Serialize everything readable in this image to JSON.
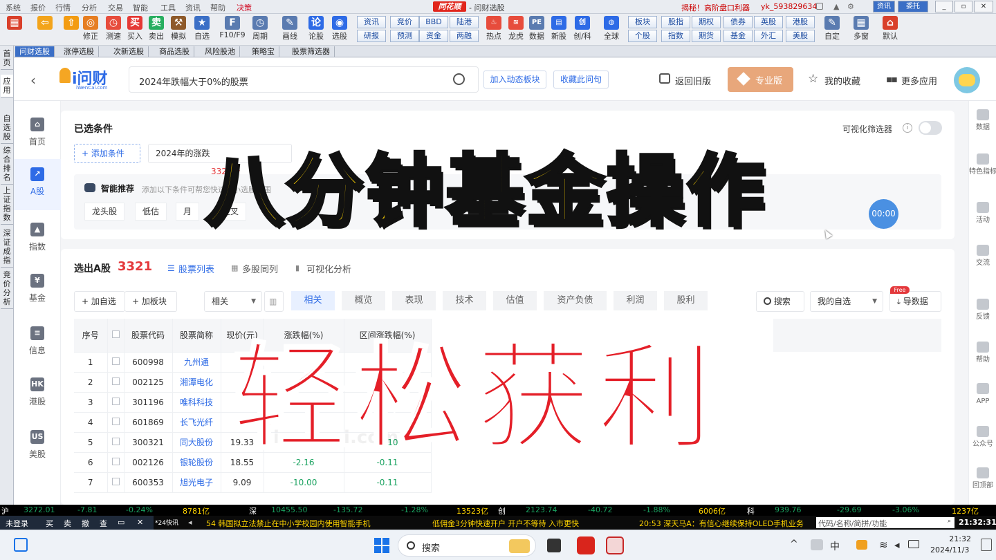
{
  "menubar": {
    "items": [
      "系统",
      "报价",
      "行情",
      "分析",
      "交易",
      "智能",
      "工具",
      "资讯",
      "帮助",
      "决策"
    ],
    "app_logo": "同花顺",
    "caption": "- 问财选股",
    "promo": "揭秘！高阶盘口利器",
    "user": "yk_593829634",
    "news_btn": "资讯",
    "account_btn": "委托",
    "win": [
      "_",
      "▫",
      "✕"
    ]
  },
  "toolbar": {
    "tools": [
      {
        "label": "",
        "color": "#d9402b",
        "icon": "▦"
      },
      {
        "label": "",
        "color": "#f3a41b",
        "icon": "⇦"
      },
      {
        "label": "",
        "color": "#f39c12",
        "icon": "⇧"
      },
      {
        "label": "修正",
        "color": "#e67e22",
        "icon": "◎"
      },
      {
        "label": "测速",
        "color": "#e74c3c",
        "icon": "◷"
      },
      {
        "label": "买入",
        "color": "#e53935",
        "icon": "买"
      },
      {
        "label": "卖出",
        "color": "#27ae60",
        "icon": "卖"
      },
      {
        "label": "模拟",
        "color": "#8e5a2b",
        "icon": "⚒"
      },
      {
        "label": "自选",
        "color": "#3b6fc6",
        "icon": "★"
      },
      {
        "label": "F10/F9",
        "color": "#5a7bb0",
        "icon": "F"
      },
      {
        "label": "周期",
        "color": "#5a7bb0",
        "icon": "◷"
      },
      {
        "label": "画线",
        "color": "#5a7bb0",
        "icon": "✎"
      },
      {
        "label": "论股",
        "color": "#2e6be6",
        "icon": "论"
      },
      {
        "label": "选股",
        "color": "#2e6be6",
        "icon": "◉"
      }
    ],
    "quick": [
      [
        "资讯",
        "研报"
      ],
      [
        "竞价",
        "预测"
      ],
      [
        "BBD",
        "资金"
      ],
      [
        "陆港",
        "两融"
      ]
    ],
    "tools2": [
      {
        "label": "热点",
        "icon": "♨",
        "color": "#e74c3c"
      },
      {
        "label": "龙虎",
        "icon": "≋",
        "color": "#e74c3c"
      },
      {
        "label": "数据",
        "icon": "PE",
        "color": "#5a7bb0"
      },
      {
        "label": "新股",
        "icon": "▤",
        "color": "#2e6be6"
      },
      {
        "label": "创/科",
        "icon": "创",
        "color": "#2e6be6"
      },
      {
        "label": "全球",
        "icon": "◍",
        "color": "#2e6be6"
      }
    ],
    "quick2": [
      [
        "板块",
        "个股"
      ],
      [
        "股指",
        "指数"
      ],
      [
        "期权",
        "期货"
      ],
      [
        "债券",
        "基金"
      ],
      [
        "英股",
        "外汇"
      ],
      [
        "港股",
        "美股"
      ]
    ],
    "tools3": [
      {
        "label": "自定",
        "icon": "✎",
        "color": "#5a7bb0"
      },
      {
        "label": "多窗",
        "icon": "▦",
        "color": "#5a7bb0"
      },
      {
        "label": "默认",
        "icon": "⌂",
        "color": "#d9402b"
      }
    ]
  },
  "tabs": [
    "问财选股",
    "涨停选股",
    "次新选股",
    "商品选股",
    "风险股池",
    "策略宝",
    "股票筛选器"
  ],
  "vtabs": [
    "首页",
    "应用",
    "自选股",
    "综合排名",
    "上证指数",
    "深证成指",
    "竞价分析"
  ],
  "header": {
    "logo": "i问财",
    "logo_sub": "iWenCai.com",
    "query": "2024年跌幅大于0%的股票",
    "add_block": "加入动态板块",
    "save_query": "收藏此问句",
    "back_old": "返回旧版",
    "pro": "专业版",
    "favorites": "我的收藏",
    "more_apps": "更多应用"
  },
  "leftnav": [
    {
      "label": "首页",
      "icon": "⌂"
    },
    {
      "label": "A股",
      "icon": "↗"
    },
    {
      "label": "指数",
      "icon": "▲"
    },
    {
      "label": "基金",
      "icon": "¥"
    },
    {
      "label": "信息",
      "icon": "≡"
    },
    {
      "label": "港股",
      "icon": "HK"
    },
    {
      "label": "美股",
      "icon": "US"
    }
  ],
  "rightrail": [
    "数据",
    "特色指标",
    "活动",
    "交流",
    "反馈",
    "帮助",
    "APP",
    "公众号",
    "回顶部"
  ],
  "conditions": {
    "title": "已选条件",
    "visual_filter": "可视化筛选器",
    "add_condition": "+ 添加条件",
    "chip": "2024年的涨跌",
    "chip_count": "3321个",
    "smart_title": "智能推荐",
    "smart_hint": "添加以下条件可帮您快速缩小选股范围",
    "recs": [
      "龙头股",
      "低估",
      "月",
      "金叉"
    ],
    "timer": "00:00"
  },
  "results": {
    "label": "选出A股",
    "count": "3321",
    "view_list": "股票列表",
    "view_multi": "多股同列",
    "view_visual": "可视化分析",
    "add_watch": "+ 加自选",
    "add_block": "+ 加板块",
    "sort": "相关",
    "filters": [
      "相关",
      "概览",
      "表现",
      "技术",
      "估值",
      "资产负债",
      "利润",
      "股利"
    ],
    "search": "搜索",
    "my_watch": "我的自选",
    "export": "导数据",
    "free": "Free"
  },
  "table": {
    "headers": [
      "序号",
      "",
      "股票代码",
      "股票简称",
      "现价(元)",
      "涨跌幅(%)",
      "区间涨跌幅(%)"
    ],
    "rows": [
      [
        "1",
        "",
        "600998",
        "九州通",
        "",
        "",
        ""
      ],
      [
        "2",
        "",
        "002125",
        "湘潭电化",
        "",
        "",
        ""
      ],
      [
        "3",
        "",
        "301196",
        "唯科科技",
        "",
        "",
        ""
      ],
      [
        "4",
        "",
        "601869",
        "长飞光纤",
        "",
        "",
        ""
      ],
      [
        "5",
        "",
        "300321",
        "同大股份",
        "19.33",
        "-6.62",
        "-0.10"
      ],
      [
        "6",
        "",
        "002126",
        "银轮股份",
        "18.55",
        "-2.16",
        "-0.11"
      ],
      [
        "7",
        "",
        "600353",
        "旭光电子",
        "9.09",
        "-10.00",
        "-0.11"
      ]
    ],
    "watermark": "iwencai.com"
  },
  "overlay": {
    "line1": "八分钟基金操作",
    "line2": "轻松获利"
  },
  "ticker": [
    {
      "t": "沪",
      "c": "#fff"
    },
    {
      "t": "3272.01",
      "c": "#1aa260"
    },
    {
      "t": "-7.81",
      "c": "#1aa260"
    },
    {
      "t": "-0.24%",
      "c": "#1aa260"
    },
    {
      "t": "8781亿",
      "c": "#ffd400"
    },
    {
      "t": "深",
      "c": "#fff"
    },
    {
      "t": "10455.50",
      "c": "#1aa260"
    },
    {
      "t": "-135.72",
      "c": "#1aa260"
    },
    {
      "t": "-1.28%",
      "c": "#1aa260"
    },
    {
      "t": "13523亿",
      "c": "#ffd400"
    },
    {
      "t": "创",
      "c": "#fff"
    },
    {
      "t": "2123.74",
      "c": "#1aa260"
    },
    {
      "t": "-40.72",
      "c": "#1aa260"
    },
    {
      "t": "-1.88%",
      "c": "#1aa260"
    },
    {
      "t": "6006亿",
      "c": "#ffd400"
    },
    {
      "t": "科",
      "c": "#fff"
    },
    {
      "t": "939.76",
      "c": "#1aa260"
    },
    {
      "t": "-29.69",
      "c": "#1aa260"
    },
    {
      "t": "-3.06%",
      "c": "#1aa260"
    },
    {
      "t": "1237亿",
      "c": "#ffd400"
    }
  ],
  "news": {
    "login": "未登录",
    "buy": "买",
    "sell": "卖",
    "cancel": "撤",
    "query": "查",
    "flash": "*24快讯",
    "items": [
      "54 韩国拟立法禁止在中小学校园内使用智能手机",
      "低佣金3分钟快速开户 开户不等待 入市更快",
      "20:53 深天马A：有信心继续保持OLED手机业务"
    ],
    "code_input": "代码/名称/简拼/功能",
    "clock": "21:32:31"
  },
  "taskbar": {
    "search": "搜索",
    "time": "21:32",
    "date": "2024/11/3",
    "lang": "中"
  }
}
